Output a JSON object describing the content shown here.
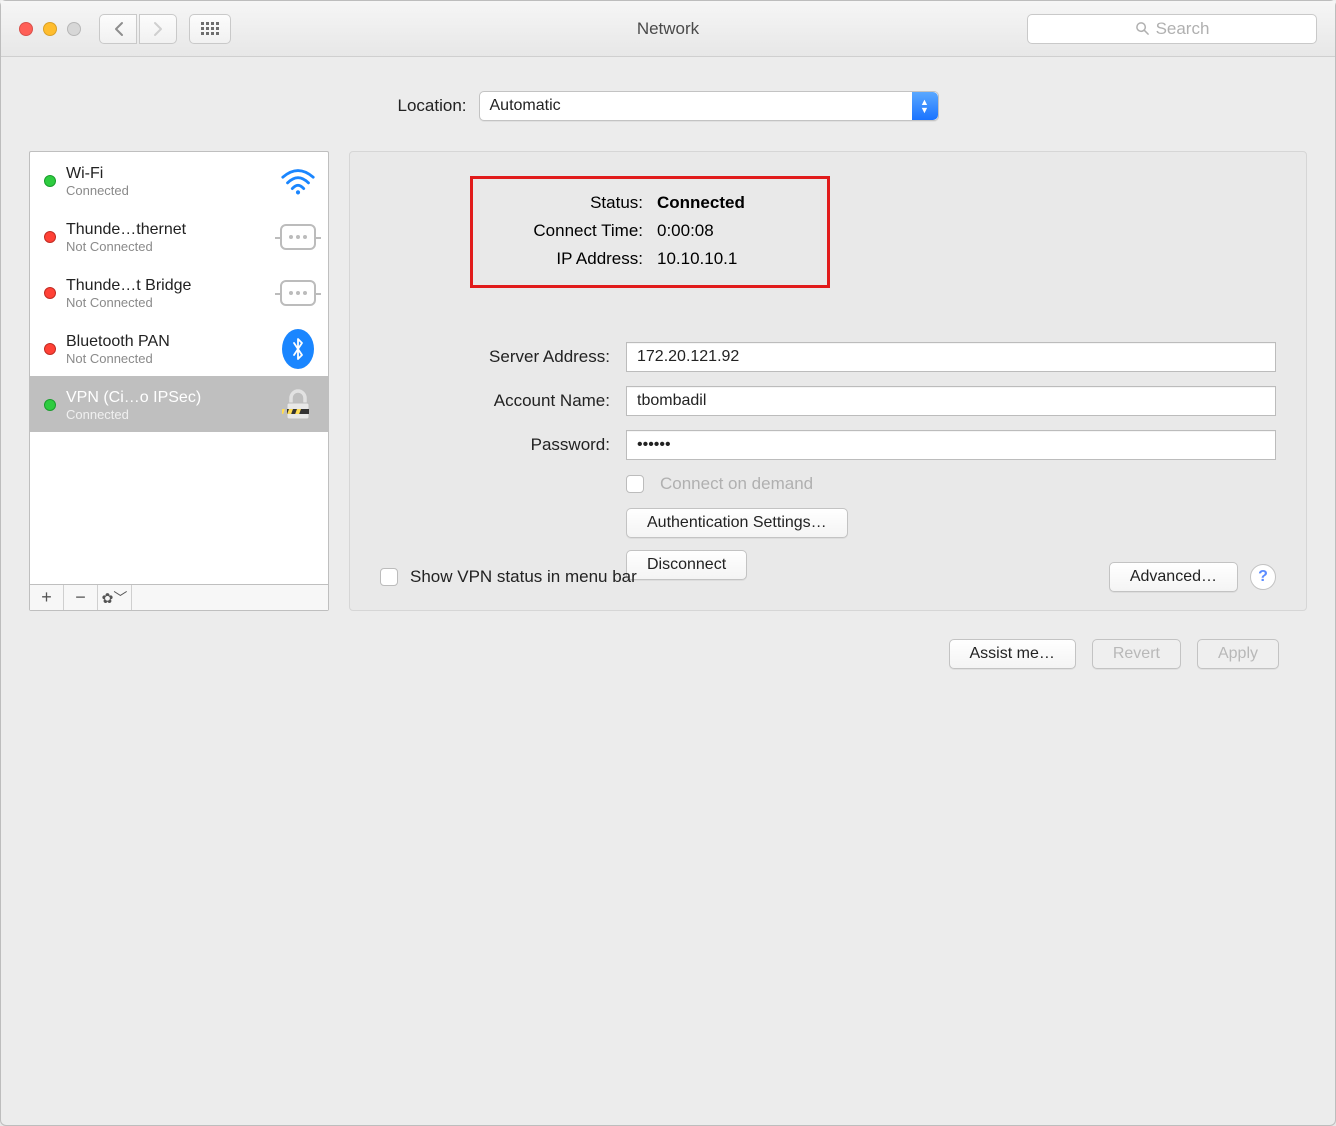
{
  "window": {
    "title": "Network",
    "search_placeholder": "Search"
  },
  "location": {
    "label": "Location:",
    "value": "Automatic"
  },
  "services": [
    {
      "name": "Wi-Fi",
      "status": "Connected",
      "color": "green",
      "icon": "wifi"
    },
    {
      "name": "Thunde…thernet",
      "status": "Not Connected",
      "color": "red",
      "icon": "thunderbolt"
    },
    {
      "name": "Thunde…t Bridge",
      "status": "Not Connected",
      "color": "red",
      "icon": "thunderbolt"
    },
    {
      "name": "Bluetooth PAN",
      "status": "Not Connected",
      "color": "red",
      "icon": "bluetooth"
    },
    {
      "name": "VPN (Ci…o IPSec)",
      "status": "Connected",
      "color": "green",
      "icon": "lock",
      "selected": true
    }
  ],
  "status": {
    "status_label": "Status:",
    "status_value": "Connected",
    "time_label": "Connect Time:",
    "time_value": "0:00:08",
    "ip_label": "IP Address:",
    "ip_value": "10.10.10.1"
  },
  "form": {
    "server_label": "Server Address:",
    "server_value": "172.20.121.92",
    "account_label": "Account Name:",
    "account_value": "tbombadil",
    "password_label": "Password:",
    "password_value": "••••••",
    "connect_on_demand": "Connect on demand",
    "auth_settings": "Authentication Settings…",
    "disconnect": "Disconnect"
  },
  "bottom": {
    "show_vpn_label": "Show VPN status in menu bar",
    "advanced": "Advanced…"
  },
  "footer": {
    "assist": "Assist me…",
    "revert": "Revert",
    "apply": "Apply"
  }
}
